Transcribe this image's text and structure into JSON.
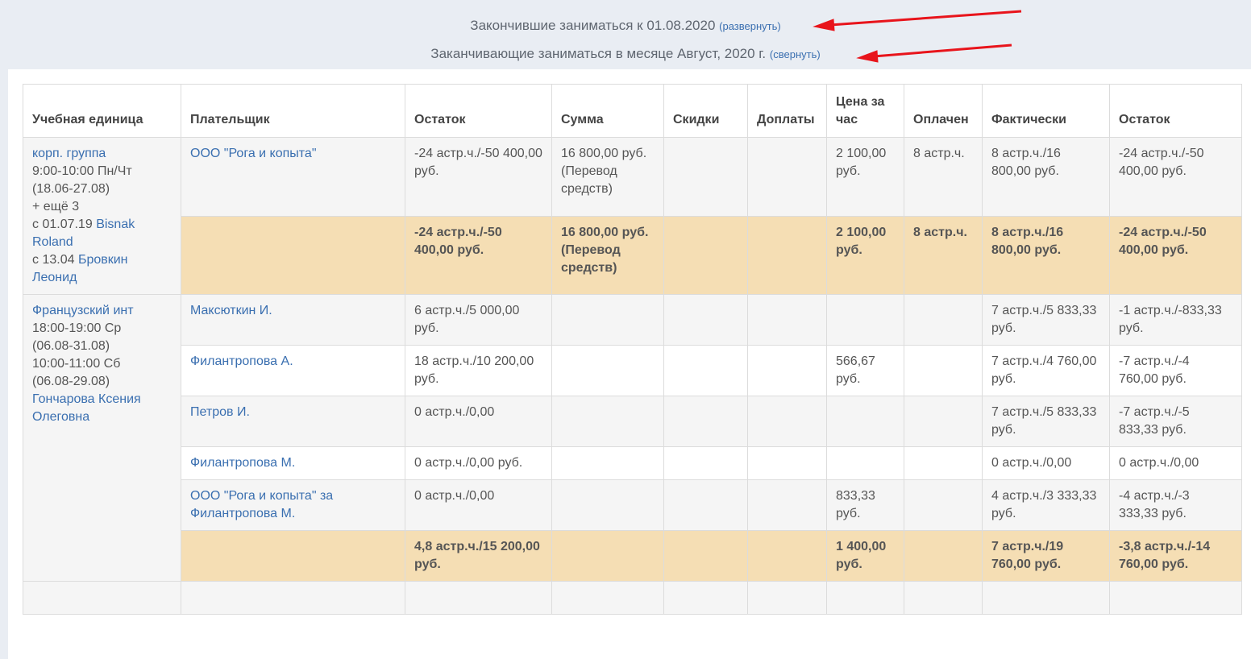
{
  "headers": {
    "finished": {
      "text": "Закончившие заниматься к 01.08.2020",
      "link": "(развернуть)"
    },
    "finishing": {
      "text": "Заканчивающие заниматься в месяце Август, 2020 г.",
      "link": "(свернуть)"
    }
  },
  "colors": {
    "accent": "#3a6fb0",
    "total_row": "#f5deb4",
    "arrow": "#e8141b"
  },
  "table": {
    "columns": [
      "Учебная единица",
      "Плательщик",
      "Остаток",
      "Сумма",
      "Скидки",
      "Доплаты",
      "Цена за час",
      "Оплачен",
      "Фактически",
      "Остаток"
    ],
    "groups": [
      {
        "unit": {
          "name": "корп. группа",
          "schedule": [
            "9:00-10:00 Пн/Чт",
            "(18.06-27.08)",
            "+ ещё 3"
          ],
          "students": [
            {
              "prefix": "с 01.07.19",
              "name": "Bisnak Roland"
            },
            {
              "prefix": "с 13.04",
              "name": "Бровкин Леонид"
            }
          ]
        },
        "rows": [
          {
            "payer": "ООО \"Рога и копыта\"",
            "balance": "-24 астр.ч./-50 400,00 руб.",
            "sum": "16 800,00 руб. (Перевод средств)",
            "discounts": "",
            "surcharges": "",
            "price": "2 100,00 руб.",
            "paid": "8 астр.ч.",
            "actual": "8 астр.ч./16 800,00 руб.",
            "remainder": "-24 астр.ч./-50 400,00 руб."
          }
        ],
        "total": {
          "balance": "-24 астр.ч./-50 400,00 руб.",
          "sum": "16 800,00 руб. (Перевод средств)",
          "price": "2 100,00 руб.",
          "paid": "8 астр.ч.",
          "actual": "8 астр.ч./16 800,00 руб.",
          "remainder": "-24 астр.ч./-50 400,00 руб."
        }
      },
      {
        "unit": {
          "name": "Французский инт",
          "schedule": [
            "18:00-19:00 Ср",
            "(06.08-31.08)",
            "10:00-11:00 Сб",
            "(06.08-29.08)"
          ],
          "teacher": "Гончарова Ксения Олеговна"
        },
        "rows": [
          {
            "payer": "Максюткин И.",
            "balance": "6 астр.ч./5 000,00 руб.",
            "sum": "",
            "discounts": "",
            "surcharges": "",
            "price": "",
            "paid": "",
            "actual": "7 астр.ч./5 833,33 руб.",
            "remainder": "-1 астр.ч./-833,33 руб."
          },
          {
            "payer": "Филантропова А.",
            "balance": "18 астр.ч./10 200,00 руб.",
            "sum": "",
            "discounts": "",
            "surcharges": "",
            "price": "566,67 руб.",
            "paid": "",
            "actual": "7 астр.ч./4 760,00 руб.",
            "remainder": "-7 астр.ч./-4 760,00 руб."
          },
          {
            "payer": "Петров И.",
            "balance": "0 астр.ч./0,00",
            "sum": "",
            "discounts": "",
            "surcharges": "",
            "price": "",
            "paid": "",
            "actual": "7 астр.ч./5 833,33 руб.",
            "remainder": "-7 астр.ч./-5 833,33 руб."
          },
          {
            "payer": "Филантропова М.",
            "balance": "0 астр.ч./0,00 руб.",
            "sum": "",
            "discounts": "",
            "surcharges": "",
            "price": "",
            "paid": "",
            "actual": "0 астр.ч./0,00",
            "remainder": "0 астр.ч./0,00"
          },
          {
            "payer": "ООО \"Рога и копыта\" за Филантропова М.",
            "balance": "0 астр.ч./0,00",
            "sum": "",
            "discounts": "",
            "surcharges": "",
            "price": "833,33 руб.",
            "paid": "",
            "actual": "4 астр.ч./3 333,33 руб.",
            "remainder": "-4 астр.ч./-3 333,33 руб."
          }
        ],
        "total": {
          "balance": "4,8 астр.ч./15 200,00 руб.",
          "sum": "",
          "price": "1 400,00 руб.",
          "paid": "",
          "actual": "7 астр.ч./19 760,00 руб.",
          "remainder": "-3,8 астр.ч./-14 760,00 руб."
        }
      }
    ]
  }
}
